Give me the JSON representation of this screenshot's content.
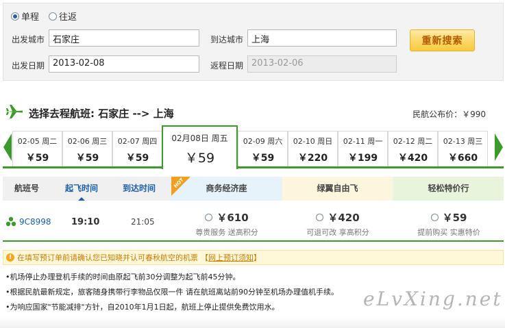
{
  "search": {
    "trip_types": [
      {
        "label": "单程",
        "checked": true
      },
      {
        "label": "往返",
        "checked": false
      }
    ],
    "depart_city_label": "出发城市",
    "depart_city_value": "石家庄",
    "arrive_city_label": "到达城市",
    "arrive_city_value": "上海",
    "depart_date_label": "出发日期",
    "depart_date_value": "2013-02-08",
    "return_date_label": "返程日期",
    "return_date_value": "2013-02-06",
    "research_button": "重新搜索"
  },
  "route": {
    "title": "选择去程航班: 石家庄 --> 上海",
    "public_price": "民航公布价：￥990"
  },
  "dates": [
    {
      "date": "02-05 周二",
      "price": "￥59"
    },
    {
      "date": "02-06 周三",
      "price": "￥59"
    },
    {
      "date": "02-07 周四",
      "price": "￥59"
    },
    {
      "date": "02月08日 周五",
      "price": "￥59",
      "active": true
    },
    {
      "date": "02-09 周六",
      "price": "￥59"
    },
    {
      "date": "02-10 周日",
      "price": "￥220"
    },
    {
      "date": "02-11 周一",
      "price": "￥199"
    },
    {
      "date": "02-12 周二",
      "price": "￥420"
    },
    {
      "date": "02-13 周三",
      "price": "￥660"
    }
  ],
  "table": {
    "col_flight": "航班号",
    "col_depart": "起飞时间",
    "col_arrive": "到达时间",
    "hot_badge": "HOT",
    "cabins": [
      {
        "label": "商务经济座",
        "color": "#e7f3fb"
      },
      {
        "label": "绿翼自由飞",
        "color": "#fdf6de"
      },
      {
        "label": "轻松特价行",
        "color": "#e8f5dc"
      }
    ]
  },
  "flight": {
    "number": "9C8998",
    "depart": "19:10",
    "arrive": "21:05",
    "options": [
      {
        "price": "￥610",
        "desc": "尊贵服务  送高积分"
      },
      {
        "price": "￥420",
        "desc": "可退可改  享高积分"
      },
      {
        "price": "￥59",
        "desc": "提前购买  实惠特价"
      }
    ]
  },
  "notice": {
    "warn_icon": "!",
    "warn_text": "在填写预订单前请确认您已知晓并认可春秋航空的机票",
    "warn_link_open": "【",
    "warn_link": "网上预订须知",
    "warn_link_close": "】",
    "bullets": [
      "•机场停止办理登机手续的时间由原起飞前30分调整为起飞前45分钟。",
      "•根据民航最新规定，旅客随身携带行李物品仅限一件 请在航班离站前90分钟至机场办理值机手续。",
      "•为响应国家\"节能减排\"方针，自2010年1月1日起，航班上停止提供免费饮用水。"
    ]
  },
  "watermark": "eLvXing.net",
  "colors": {
    "accent_green": "#3a9a2a",
    "link_blue": "#1d5ea8",
    "button_orange": "#f9c93a"
  }
}
